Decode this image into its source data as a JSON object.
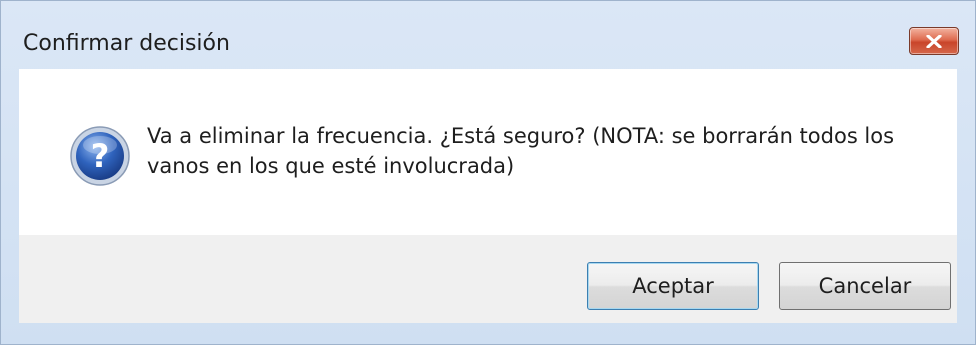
{
  "window": {
    "title": "Confirmar decisión",
    "close_icon": "close-icon"
  },
  "message": {
    "icon": "question-icon",
    "line1": "Va a eliminar la frecuencia. ¿Está seguro? (NOTA: se borrarán todos los",
    "line2": "vanos en los que esté involucrada)"
  },
  "buttons": {
    "accept_label": "Aceptar",
    "cancel_label": "Cancelar"
  },
  "colors": {
    "close_button": "#d5674b",
    "icon_blue": "#2a5db0",
    "default_button_border": "#3c7fb1"
  }
}
